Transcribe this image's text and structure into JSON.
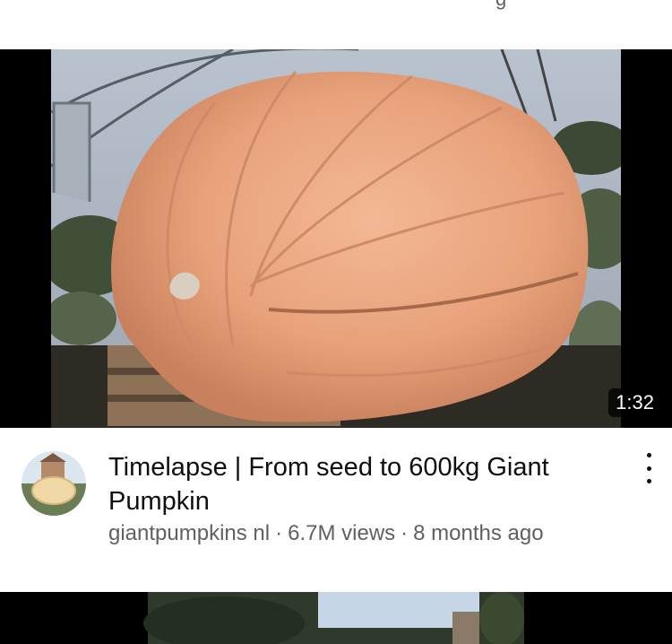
{
  "feed": {
    "video": {
      "duration": "1:32",
      "title": "Timelapse | From seed to 600kg Giant Pumpkin",
      "channel": "giantpumpkins nl",
      "views": "6.7M views",
      "age": "8 months ago",
      "separator": "·"
    },
    "icons": {
      "menu": "more-vert-icon"
    },
    "colors": {
      "pumpkin": "#e7a27a",
      "text_primary": "#0f0f0f",
      "text_secondary": "#606060"
    }
  }
}
